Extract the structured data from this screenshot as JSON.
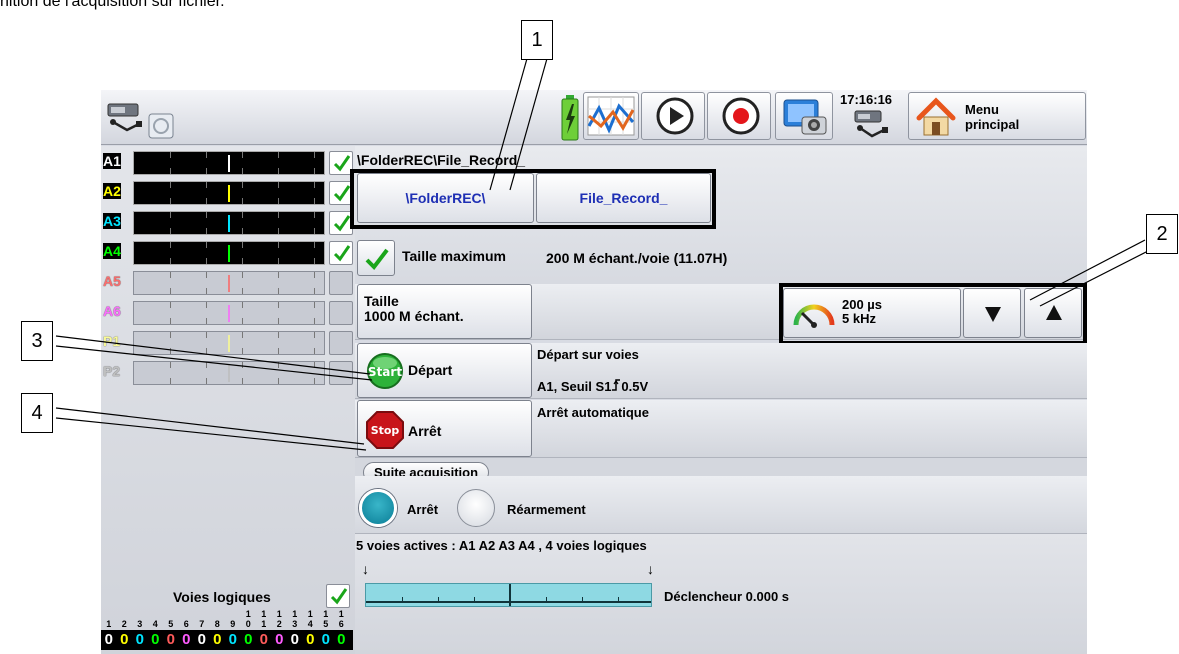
{
  "caption": "nition de l'acquisition sur fichier.",
  "callouts": [
    "1",
    "2",
    "3",
    "4"
  ],
  "topbar": {
    "time": "17:16:16",
    "menu_line1": "Menu",
    "menu_line2": "principal",
    "icons": [
      "usb-drive-icon",
      "battery-charging-icon",
      "chart-icon",
      "play-icon",
      "record-icon",
      "screenshot-camera-icon",
      "usb-icon",
      "home-icon"
    ]
  },
  "channels": [
    {
      "label": "A1",
      "color": "#ffffff",
      "active": true
    },
    {
      "label": "A2",
      "color": "#ffff00",
      "active": true
    },
    {
      "label": "A3",
      "color": "#00e5ff",
      "active": true
    },
    {
      "label": "A4",
      "color": "#00ff00",
      "active": true
    },
    {
      "label": "A5",
      "color": "#ff5b5b",
      "active": false
    },
    {
      "label": "A6",
      "color": "#ff5bff",
      "active": false
    },
    {
      "label": "P1",
      "color": "#ffff88",
      "active": false
    },
    {
      "label": "P2",
      "color": "#bbbbbb",
      "active": false
    }
  ],
  "logic": {
    "label": "Voies logiques",
    "digits_top": [
      "",
      "",
      "",
      "",
      "",
      "",
      "",
      "",
      "",
      "1",
      "1",
      "1",
      "1",
      "1",
      "1",
      "1"
    ],
    "digits_bottom": [
      "1",
      "2",
      "3",
      "4",
      "5",
      "6",
      "7",
      "8",
      "9",
      "0",
      "1",
      "2",
      "3",
      "4",
      "5",
      "6"
    ],
    "states": [
      "0",
      "0",
      "0",
      "0",
      "0",
      "0",
      "0",
      "0",
      "0",
      "0",
      "0",
      "0",
      "0",
      "0",
      "0",
      "0"
    ],
    "state_colors": [
      "#ffffff",
      "#ffff00",
      "#00e5ff",
      "#00ff00",
      "#ff5b5b",
      "#ff5bff",
      "#ffffff",
      "#ffff00",
      "#00e5ff",
      "#00ff00",
      "#ff5b5b",
      "#ff5bff",
      "#ffffff",
      "#ffff00",
      "#00e5ff",
      "#00ff00"
    ]
  },
  "file": {
    "path": "\\FolderREC\\File_Record_",
    "folder_button": "\\FolderREC\\",
    "file_button": "File_Record_"
  },
  "size": {
    "max_label": "Taille maximum",
    "max_value": "200 M échant./voie (11.07H)",
    "size_line1": "Taille",
    "size_line2": "1000  M échant."
  },
  "sampling": {
    "period": "200 µs",
    "frequency": "5 kHz"
  },
  "start": {
    "button": "Départ",
    "badge": "Start",
    "info_line1": "Départ  sur voies",
    "info_line2": "A1, Seuil S1",
    "threshold": "0.5V"
  },
  "stop": {
    "button": "Arrêt",
    "badge": "Stop",
    "info": "Arrêt automatique"
  },
  "suite": {
    "label": "Suite acquisition",
    "option1": "Arrêt",
    "option2": "Réarmement",
    "selected": "Arrêt"
  },
  "summary": {
    "text": "5 voies actives : A1 A2 A3 A4 , 4 voies logiques",
    "trigger": "Déclencheur 0.000 s",
    "arrow": "↓"
  }
}
